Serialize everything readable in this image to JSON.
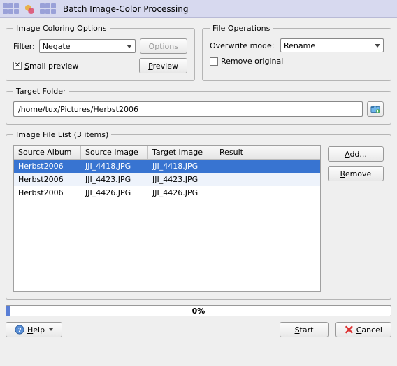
{
  "titlebar": {
    "title": "Batch Image-Color Processing"
  },
  "coloring": {
    "legend": "Image Coloring Options",
    "filter_label": "Filter:",
    "filter_value": "Negate",
    "options_btn": "Options",
    "small_preview_label": "Small preview",
    "preview_btn": "Preview"
  },
  "fileops": {
    "legend": "File Operations",
    "overwrite_label": "Overwrite mode:",
    "overwrite_value": "Rename",
    "remove_original_label": "Remove original"
  },
  "target": {
    "legend": "Target Folder",
    "path": "/home/tux/Pictures/Herbst2006"
  },
  "filelist": {
    "legend": "Image File List (3 items)",
    "headers": {
      "album": "Source Album",
      "source": "Source Image",
      "target": "Target Image",
      "result": "Result"
    },
    "rows": [
      {
        "album": "Herbst2006",
        "source": "JJI_4418.JPG",
        "target": "JJI_4418.JPG",
        "result": ""
      },
      {
        "album": "Herbst2006",
        "source": "JJI_4423.JPG",
        "target": "JJI_4423.JPG",
        "result": ""
      },
      {
        "album": "Herbst2006",
        "source": "JJI_4426.JPG",
        "target": "JJI_4426.JPG",
        "result": ""
      }
    ],
    "add_btn": "Add...",
    "remove_btn": "Remove"
  },
  "progress": {
    "text": "0%"
  },
  "bottom": {
    "help": "Help",
    "start": "Start",
    "cancel": "Cancel"
  }
}
